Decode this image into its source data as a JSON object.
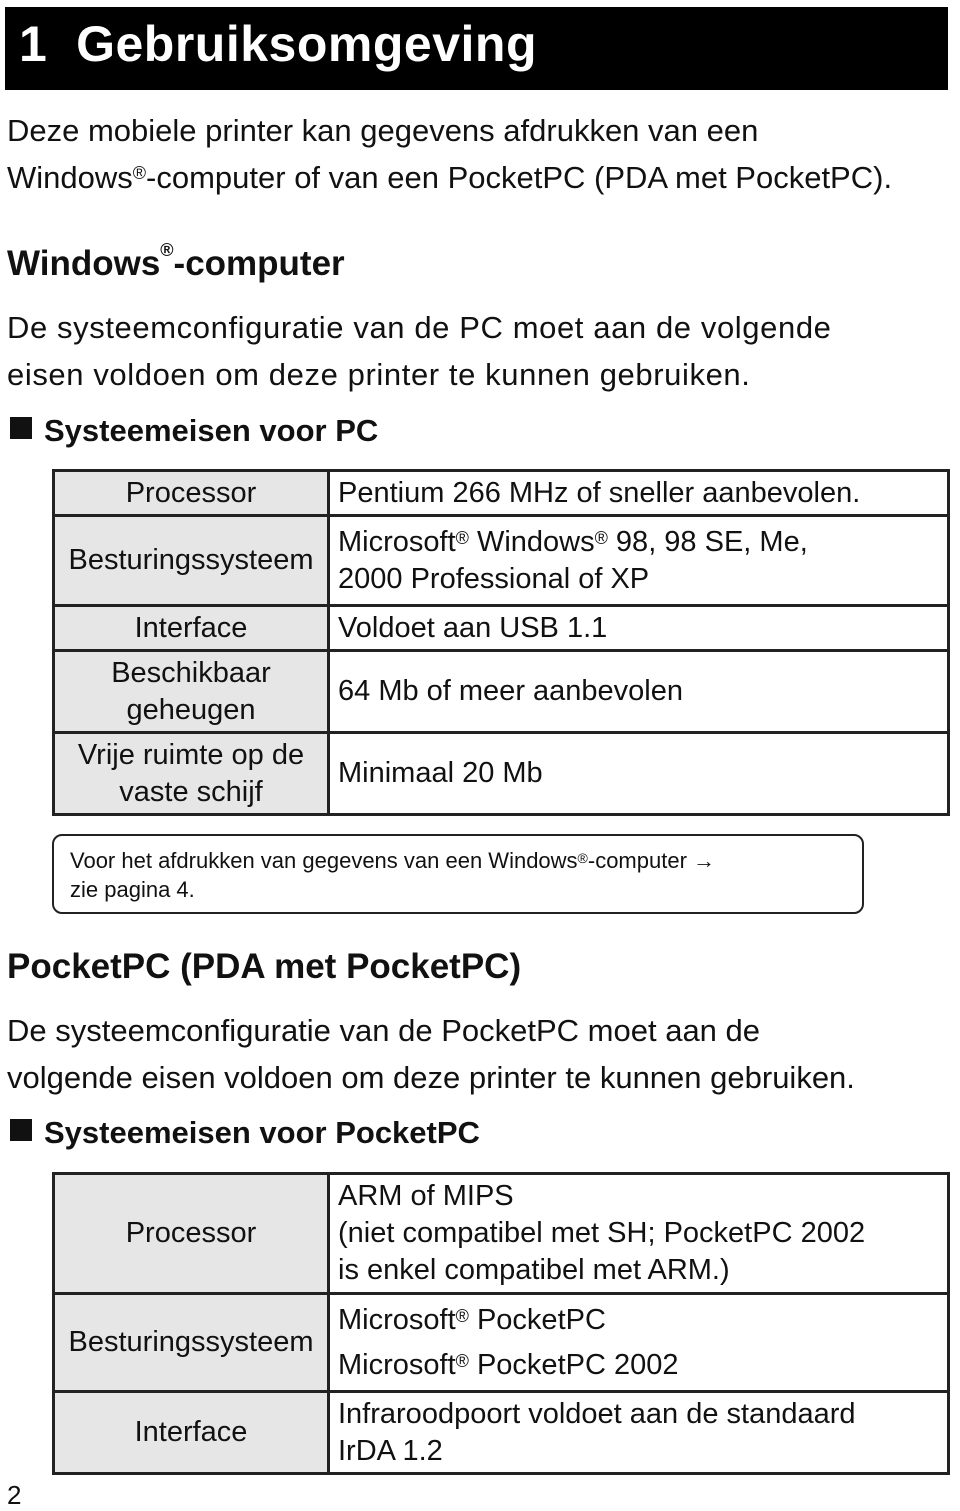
{
  "chapter": {
    "number": "1",
    "title": "Gebruiksomgeving"
  },
  "intro": {
    "line1": "Deze mobiele printer kan gegevens afdrukken van een",
    "line2_a": "Windows",
    "line2_reg": "®",
    "line2_b": "-computer of van een PocketPC (PDA met PocketPC)."
  },
  "windows_section": {
    "heading_a": "Windows",
    "heading_reg": "®",
    "heading_b": "-computer",
    "para_line1": "De systeemconfiguratie van de PC moet aan de volgende",
    "para_line2": "eisen voldoen om deze printer te kunnen gebruiken.",
    "subheading": "Systeemeisen voor PC",
    "table": [
      {
        "key": "Processor",
        "value": "Pentium 266 MHz of sneller aanbevolen."
      },
      {
        "key": "Besturingssysteem",
        "value_a": "Microsoft",
        "value_b": " Windows",
        "value_c": " 98, 98 SE, Me,",
        "value_line2": "2000 Professional of XP"
      },
      {
        "key": "Interface",
        "value": "Voldoet aan USB 1.1"
      },
      {
        "key_line1": "Beschikbaar",
        "key_line2": "geheugen",
        "value": "64 Mb of meer aanbevolen"
      },
      {
        "key_line1": "Vrije ruimte op de",
        "key_line2": "vaste schijf",
        "value": "Minimaal 20 Mb"
      }
    ],
    "note_a": "Voor het afdrukken van gegevens van een Windows",
    "note_b": "-computer →",
    "note_line2": "zie pagina 4."
  },
  "pocketpc_section": {
    "heading": "PocketPC (PDA met PocketPC)",
    "para_line1": "De systeemconfiguratie van de PocketPC moet aan de",
    "para_line2": "volgende eisen voldoen om deze printer te kunnen gebruiken.",
    "subheading": "Systeemeisen voor PocketPC",
    "table": [
      {
        "key": "Processor",
        "value_lines": [
          "ARM of MIPS",
          "(niet compatibel met SH; PocketPC 2002",
          "is enkel compatibel met ARM.)"
        ]
      },
      {
        "key": "Besturingssysteem",
        "value_lines": [
          "Microsoft",
          " PocketPC",
          "Microsoft",
          " PocketPC 2002"
        ]
      },
      {
        "key": "Interface",
        "value_lines": [
          "Infraroodpoort voldoet aan de standaard",
          "IrDA 1.2"
        ]
      }
    ]
  },
  "page_number": "2",
  "reg": "®"
}
